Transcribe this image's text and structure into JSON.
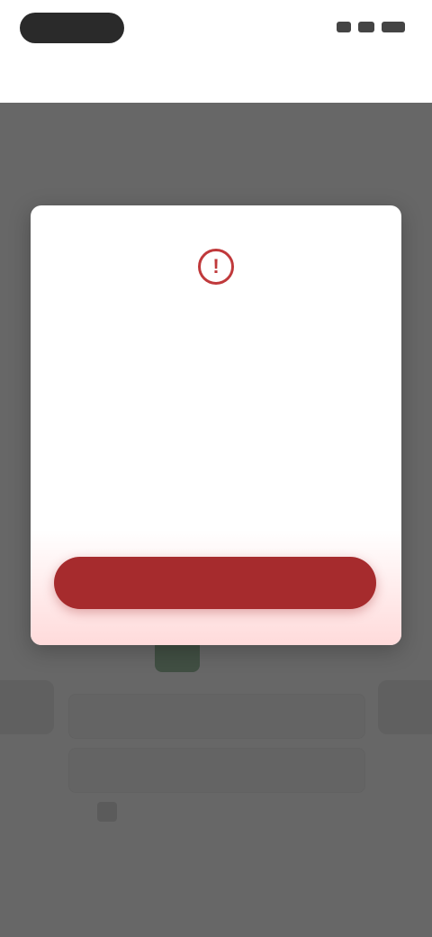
{
  "header": {
    "title": "",
    "action_label": ""
  },
  "background": {
    "heading": ""
  },
  "modal": {
    "alert_glyph": "!",
    "title": "",
    "subtitle": "",
    "body": "",
    "link_text": "",
    "primary_button_label": ""
  },
  "colors": {
    "accent_red": "#a62b2d",
    "alert_red": "#c0393b",
    "green_icon": "#2f7d3a",
    "overlay": "#464646"
  },
  "icons": {
    "modal_icon": "alert-circle-icon",
    "background_icon": "document-icon"
  }
}
